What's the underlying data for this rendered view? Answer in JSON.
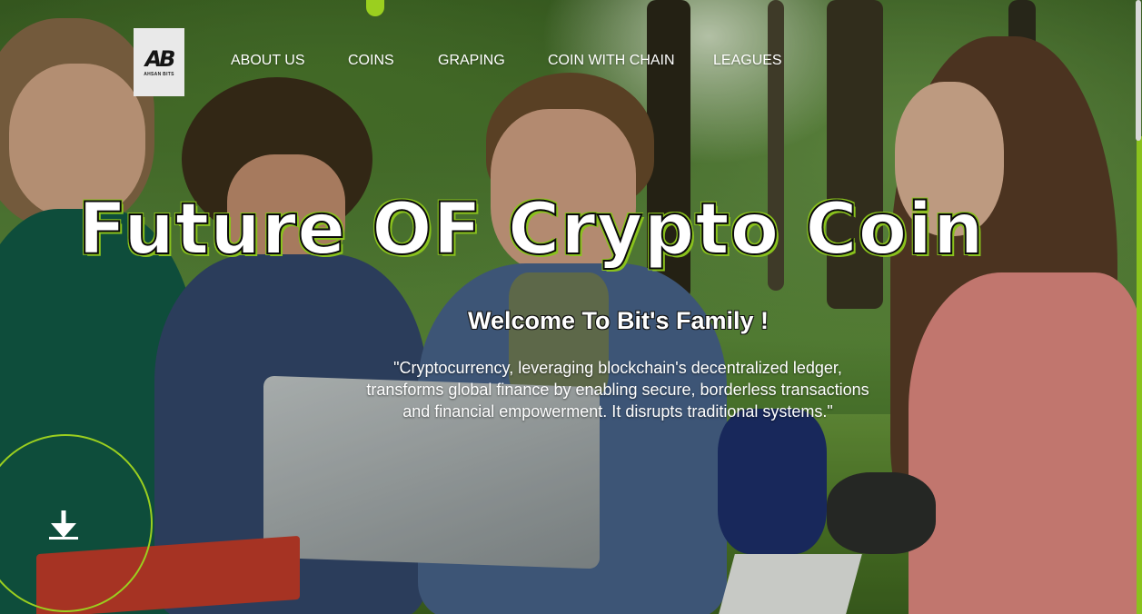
{
  "brand": {
    "logo_mark": "AB",
    "logo_text": "AHSAN BITS"
  },
  "nav": {
    "items": [
      {
        "label": "ABOUT US"
      },
      {
        "label": "COINS"
      },
      {
        "label": "GRAPING"
      },
      {
        "label": "COIN WITH CHAIN"
      },
      {
        "label": "LEAGUES"
      }
    ]
  },
  "hero": {
    "title": "Future OF Crypto Coin",
    "subtitle": "Welcome To Bit's Family !",
    "quote": "\"Cryptocurrency, leveraging blockchain's decentralized ledger, transforms global finance by enabling secure, borderless transactions and financial empowerment. It disrupts traditional systems.\""
  },
  "scroll_down": {
    "icon": "arrow-down-icon"
  },
  "colors": {
    "accent": "#9bcf1f",
    "text": "#ffffff"
  }
}
